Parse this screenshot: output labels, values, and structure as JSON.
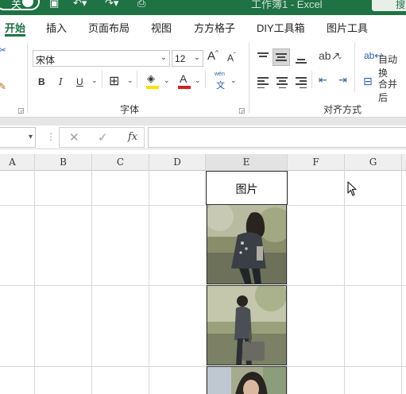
{
  "titlebar": {
    "toggle_label": "关",
    "title": "工作簿1 - Excel",
    "search_hint": "搜"
  },
  "tabs": [
    {
      "label": "开始",
      "active": true
    },
    {
      "label": "插入"
    },
    {
      "label": "页面布局"
    },
    {
      "label": "视图"
    },
    {
      "label": "方方格子"
    },
    {
      "label": "DIY工具箱"
    },
    {
      "label": "图片工具"
    }
  ],
  "ribbon": {
    "font_name": "宋体",
    "font_size": "12",
    "grow_font": "A",
    "shrink_font": "A",
    "bold": "B",
    "italic": "I",
    "underline": "U",
    "font_color_glyph": "A",
    "phonetic_top": "wén",
    "phonetic_bottom": "文",
    "font_group_label": "字体",
    "align_group_label": "对齐方式",
    "wrap_text": "自动换",
    "merge_center": "合并后",
    "colors": {
      "highlight": "#f5e400",
      "font_color": "#d42020"
    }
  },
  "formula_bar": {
    "cancel": "✕",
    "enter": "✓",
    "fx": "fx",
    "value": ""
  },
  "grid": {
    "columns": [
      "A",
      "B",
      "C",
      "D",
      "E",
      "F",
      "G"
    ],
    "cell_e1": "图片"
  }
}
